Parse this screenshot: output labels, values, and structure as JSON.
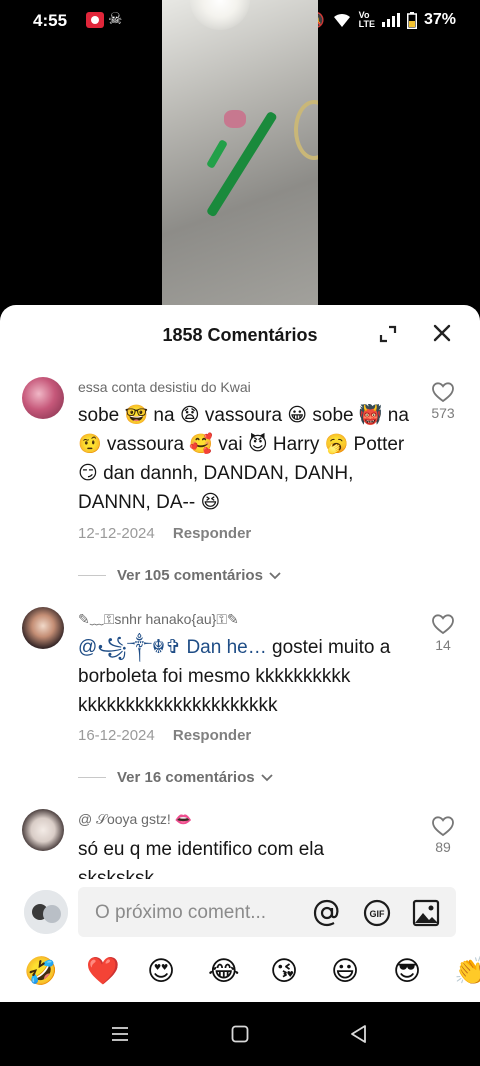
{
  "status_bar": {
    "time": "4:55",
    "battery": "37%",
    "icons": [
      "screen-record-icon",
      "pirate-icon",
      "alarm-icon",
      "mute-icon",
      "wifi-icon",
      "volte-icon",
      "signal-icon",
      "battery-icon"
    ]
  },
  "sheet": {
    "title": "1858 Comentários"
  },
  "comments": [
    {
      "username": "essa conta desistiu do Kwai",
      "text": "sobe 🤓 na 😧 vassoura 😀 sobe 👹 na 🤨 vassoura 🥰 vai 😈 Harry 🥱 Potter 😏 dan dannh, DANDAN, DANH, DANNN, DA-- 😆",
      "date": "12-12-2024",
      "reply_label": "Responder",
      "likes": "573",
      "view_more": "Ver 105 comentários"
    },
    {
      "username": "✎﹏⚿snhr hanako{au}⚿✎",
      "mention": "@꧁༒☬✞ Dan he…",
      "text": " gostei muito a borboleta foi mesmo kkkkkkkkkk kkkkkkkkkkkkkkkkkkkkk",
      "date": "16-12-2024",
      "reply_label": "Responder",
      "likes": "14",
      "view_more": "Ver 16 comentários"
    },
    {
      "username": "@ 𝒮ooya gstz! 👄",
      "text": "só eu q me identifico com ela sksksksk",
      "likes": "89"
    }
  ],
  "input": {
    "placeholder": "O próximo coment..."
  },
  "emoji_bar": [
    "🤣",
    "❤️",
    "😍",
    "😂",
    "😘",
    "😃",
    "😎",
    "👏"
  ],
  "colors": {
    "accent_mention": "#1f4d86",
    "heart": "#e02030"
  }
}
